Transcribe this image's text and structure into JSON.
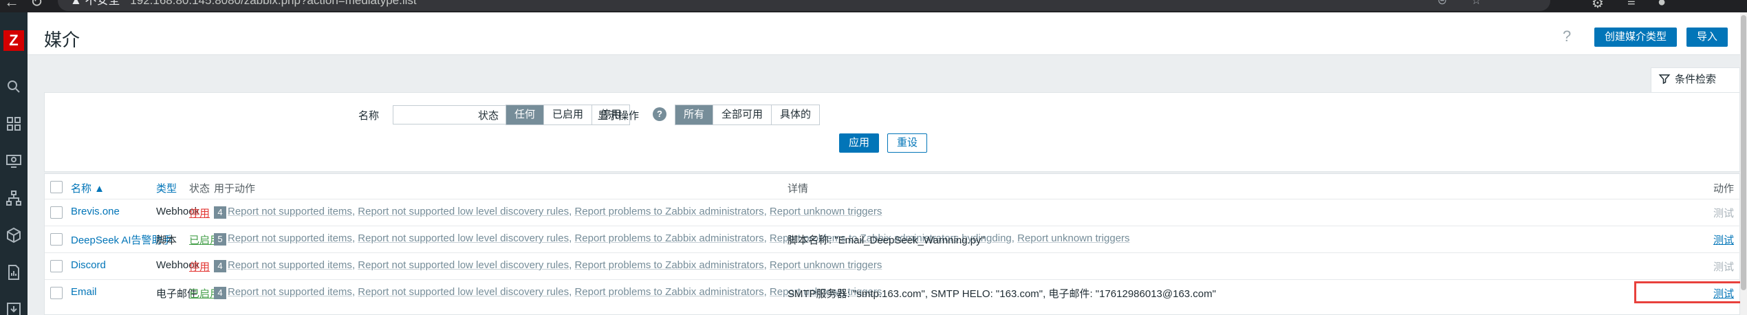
{
  "browser": {
    "security_warning": "▲ 不安全",
    "url": "192.168.80.145:8080/zabbix.php?action=mediatype.list"
  },
  "header": {
    "title": "媒介",
    "help_icon": "?",
    "create_button": "创建媒介类型",
    "import_button": "导入"
  },
  "filter": {
    "tab_label": "条件检索",
    "name_label": "名称",
    "name_value": "",
    "status_label": "状态",
    "status_options": [
      "任何",
      "已启用",
      "停用"
    ],
    "status_selected": "任何",
    "actions_label": "显示操作",
    "actions_options": [
      "所有",
      "全部可用",
      "具体的"
    ],
    "actions_selected": "所有",
    "apply_button": "应用",
    "reset_button": "重设"
  },
  "table": {
    "headers": {
      "name": "名称 ▲",
      "type": "类型",
      "status": "状态",
      "used_in_actions": "用于动作",
      "details": "详情",
      "action": "动作"
    },
    "rows": [
      {
        "name": "Brevis.one",
        "type": "Webhook",
        "status": "停用",
        "count": "4",
        "actions": [
          "Report not supported items",
          "Report not supported low level discovery rules",
          "Report problems to Zabbix administrators",
          "Report unknown triggers"
        ],
        "details": "",
        "test": "测试"
      },
      {
        "name": "DeepSeek AI告警助手",
        "type": "脚本",
        "status": "已启用",
        "count": "5",
        "actions": [
          "Report not supported items",
          "Report not supported low level discovery rules",
          "Report problems to Zabbix administrators",
          "Report problems to Zabbix administrators bydingding",
          "Report unknown triggers"
        ],
        "details": "脚本名称: \"Email_DeepSeek_Warnning.py\"",
        "test": "测试"
      },
      {
        "name": "Discord",
        "type": "Webhook",
        "status": "停用",
        "count": "4",
        "actions": [
          "Report not supported items",
          "Report not supported low level discovery rules",
          "Report problems to Zabbix administrators",
          "Report unknown triggers"
        ],
        "details": "",
        "test": "测试"
      },
      {
        "name": "Email",
        "type": "电子邮件",
        "status": "已启用",
        "count": "4",
        "actions": [
          "Report not supported items",
          "Report not supported low level discovery rules",
          "Report problems to Zabbix administrators",
          "Report unknown triggers"
        ],
        "details": "SMTP服务器: \"smtp.163.com\", SMTP HELO: \"163.com\", 电子邮件: \"17612986013@163.com\"",
        "test": "测试"
      }
    ]
  },
  "colors": {
    "accent": "#0275b8",
    "enabled": "#429e47",
    "disabled": "#e33734",
    "sidebar": "#1f2c33",
    "highlight_box": "#e8413c"
  }
}
